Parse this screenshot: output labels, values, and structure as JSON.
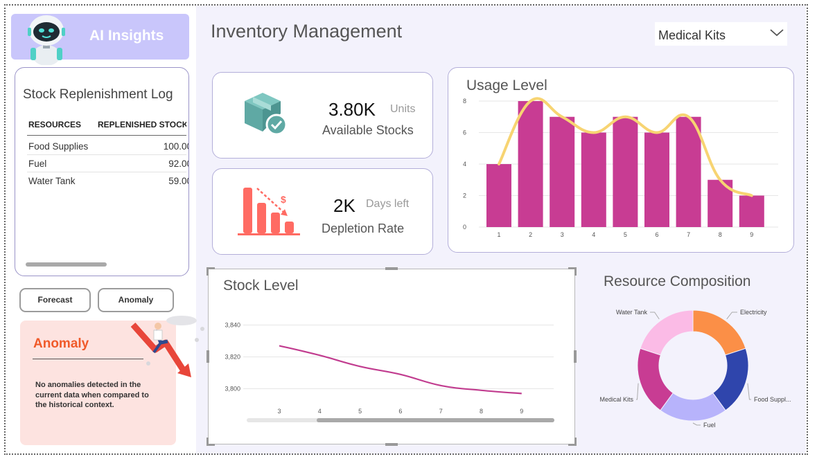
{
  "sidebar": {
    "ai_title": "AI Insights",
    "log": {
      "title": "Stock Replenishment Log",
      "columns": [
        "RESOURCES",
        "REPLENISHED STOCK"
      ],
      "rows": [
        {
          "resource": "Food Supplies",
          "value": "100.00"
        },
        {
          "resource": "Fuel",
          "value": "92.00"
        },
        {
          "resource": "Water Tank",
          "value": "59.00"
        }
      ]
    },
    "buttons": {
      "forecast": "Forecast",
      "anomaly": "Anomaly"
    },
    "anomaly": {
      "title": "Anomaly",
      "message": "No anomalies detected in the current data when compared to the historical context."
    }
  },
  "header": {
    "title": "Inventory Management",
    "filter": {
      "selected": "Medical Kits"
    }
  },
  "kpis": [
    {
      "value": "3.80K",
      "unit": "Units",
      "label": "Available Stocks"
    },
    {
      "value": "2K",
      "unit": "Days left",
      "label": "Depletion Rate"
    }
  ],
  "chart_data": [
    {
      "type": "bar",
      "title": "Usage Level",
      "categories": [
        "1",
        "2",
        "3",
        "4",
        "5",
        "6",
        "7",
        "8",
        "9"
      ],
      "series": [
        {
          "values": [
            4,
            8,
            7,
            6,
            7,
            6,
            7,
            3,
            2
          ]
        },
        {
          "values": [
            4,
            8,
            7,
            6,
            7,
            6,
            7,
            3,
            2
          ]
        }
      ],
      "yticks": [
        0,
        2,
        4,
        6,
        8
      ],
      "ylim": [
        0,
        8
      ],
      "grid": true,
      "colors": {
        "bar": "#c83c93",
        "line": "#f7d472"
      }
    },
    {
      "type": "line",
      "title": "Stock Level",
      "x": [
        "3",
        "4",
        "5",
        "6",
        "7",
        "8",
        "9"
      ],
      "values": [
        3827,
        3821,
        3814,
        3809,
        3802,
        3799,
        3797
      ],
      "yticks": [
        "3,800",
        "3,820",
        "3,840"
      ],
      "ylim": [
        3795,
        3845
      ],
      "grid": true,
      "colors": {
        "line": "#c13c8f"
      }
    },
    {
      "type": "pie",
      "title": "Resource Composition",
      "labels": [
        "Electricity",
        "Food Suppl...",
        "Fuel",
        "Medical Kits",
        "Water Tank"
      ],
      "values": [
        20,
        20,
        20,
        20,
        20
      ],
      "colors": [
        "#fb8f47",
        "#2f45ac",
        "#b7b3fb",
        "#c83c93",
        "#fbbbe6"
      ]
    }
  ]
}
